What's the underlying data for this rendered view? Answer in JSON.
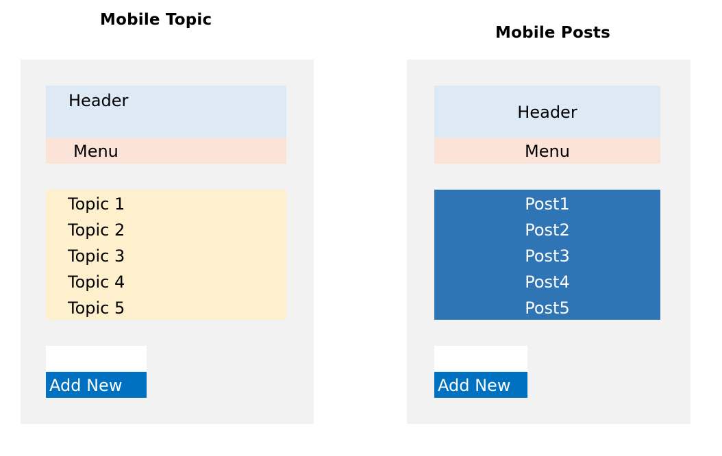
{
  "left": {
    "title": "Mobile Topic",
    "header": "Header",
    "menu": "Menu",
    "items": [
      "Topic 1",
      "Topic 2",
      "Topic 3",
      "Topic 4",
      "Topic 5"
    ],
    "add_button": "Add New"
  },
  "right": {
    "title": "Mobile Posts",
    "header": "Header",
    "menu": "Menu",
    "items": [
      "Post1",
      "Post2",
      "Post3",
      "Post4",
      "Post5"
    ],
    "add_button": "Add New"
  },
  "colors": {
    "panel_bg": "#f2f2f2",
    "header_bg": "#dde9f5",
    "menu_bg": "#fbe3d8",
    "topic_list_bg": "#fef0cc",
    "post_list_bg": "#2f75b5",
    "add_button_bg": "#0070c0"
  }
}
